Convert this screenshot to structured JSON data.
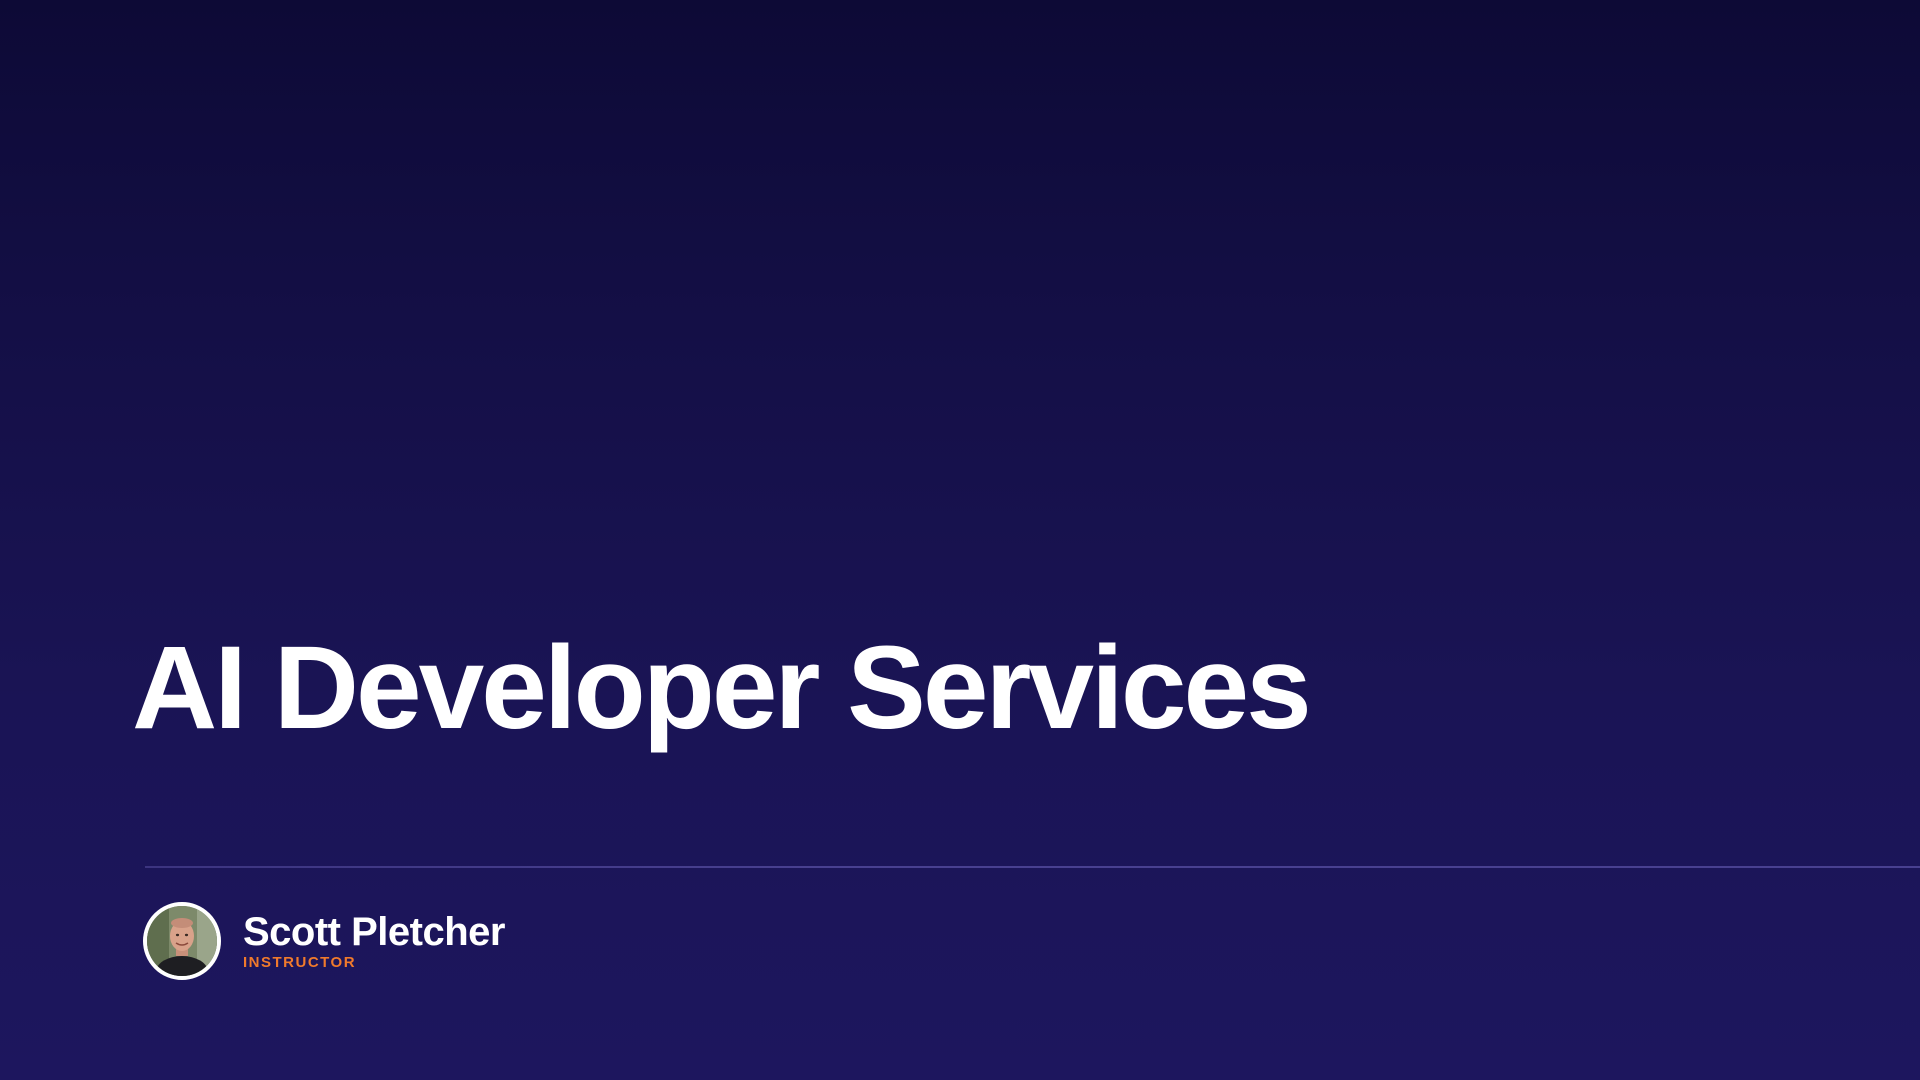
{
  "slide": {
    "title": "AI Developer Services"
  },
  "presenter": {
    "name": "Scott Pletcher",
    "role": "INSTRUCTOR",
    "avatar_icon": "person-photo-icon"
  },
  "colors": {
    "background_top": "#0d0a36",
    "background_bottom": "#1d165e",
    "title_text": "#ffffff",
    "role_accent": "#f07a2c"
  }
}
